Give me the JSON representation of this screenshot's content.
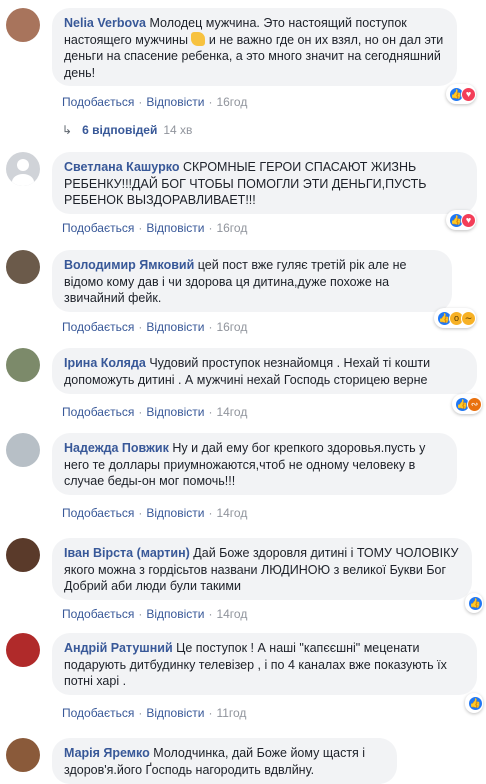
{
  "actions": {
    "like": "Подобається",
    "reply": "Відповісти",
    "sep": "·"
  },
  "comments": [
    {
      "author": "Nelia Verbova",
      "text_a": "Молодец мужчина. Это настоящий поступок настоящего мужчины ",
      "text_b": " и не важно где он их взял, но он дал эти деньги на спасение ребенка, а это много значит на сегодняшний день!",
      "time": "16год",
      "reactions": [
        "like",
        "love"
      ],
      "avatar_color": "#a8745c"
    },
    {
      "author": "Светлана Кашурко",
      "text": "СКРОМНЫЕ ГЕРОИ СПАСАЮТ ЖИЗНЬ РЕБЕНКУ!!!ДАЙ БОГ ЧТОБЫ ПОМОГЛИ ЭТИ ДЕНЬГИ,ПУСТЬ РЕБЕНОК ВЫЗДОРАВЛИВАЕТ!!!",
      "time": "16год",
      "reactions": [
        "like",
        "love"
      ],
      "avatar_color": "#d0d3d8"
    },
    {
      "author": "Володимир Ямковий",
      "text": "цей пост вже гуляє третій рік але не відомо кому дав і чи здорова ця дитина,дуже похоже на звичайний фейк.",
      "time": "16год",
      "reactions": [
        "like",
        "wow",
        "sad"
      ],
      "avatar_color": "#6b5a4a"
    },
    {
      "author": "Ірина Коляда",
      "text": "Чудовий проступок незнайомця . Нехай ті кошти допоможуть дитині . А мужчині нехай Господь сторицею верне",
      "time": "14год",
      "reactions": [
        "like",
        "angry"
      ],
      "avatar_color": "#7c8a6a"
    },
    {
      "author": "Надежда Повжик",
      "text": "Ну и дай ему бог крепкого здоровья.пусть у него те доллары приумножаются,чтоб не одному человеку в случае беды-он мог помочь!!!",
      "time": "14год",
      "reactions": [],
      "avatar_color": "#b7bfc6"
    },
    {
      "author": "Іван Вірста (мартин)",
      "text": "Дай Боже здоровля дитині і ТОМУ ЧОЛОВІКУ якого можна з гордісьтов названи ЛЮДИНОЮ з великої Букви Бог Добрий аби люди були такими",
      "time": "14год",
      "reactions": [
        "like"
      ],
      "avatar_color": "#5a3a2a"
    },
    {
      "author": "Андрій Ратушний",
      "text": "Це поступок ! А наші \"капєєшні\" меценати подарують дитбудинку телевізер , і по 4 каналах вже показують їх потні харі .",
      "time": "11год",
      "reactions": [
        "like"
      ],
      "avatar_color": "#b02a2a"
    },
    {
      "author": "Марія Яремко",
      "text": "Молодчинка, дай Боже йому щастя і здоров'я.його Ґосподь нагородить вдвлйну.",
      "time": "",
      "reactions": [],
      "avatar_color": "#8a5a3a"
    }
  ],
  "replies": {
    "label": "6 відповідей",
    "time": "14 хв"
  }
}
